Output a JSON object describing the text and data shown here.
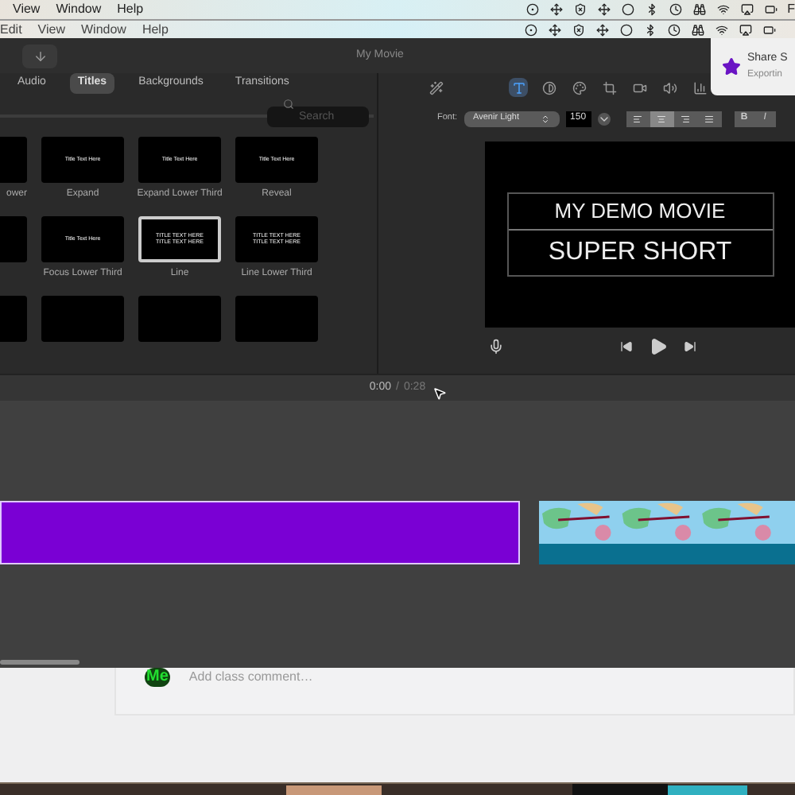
{
  "outer_menu": {
    "items": [
      "View",
      "Window",
      "Help"
    ],
    "status_text": "F"
  },
  "app_menu": {
    "items": [
      "Edit",
      "View",
      "Window",
      "Help"
    ]
  },
  "window": {
    "title": "My Movie"
  },
  "notification": {
    "title": "Share S",
    "subtitle": "Exportin"
  },
  "browser": {
    "tabs": [
      {
        "label": "Audio",
        "selected": false
      },
      {
        "label": "Titles",
        "selected": true
      },
      {
        "label": "Backgrounds",
        "selected": false
      },
      {
        "label": "Transitions",
        "selected": false
      }
    ],
    "search": {
      "placeholder": "Search"
    },
    "titles": [
      {
        "label": "ower",
        "selected": false
      },
      {
        "label": "Expand",
        "preview": [
          "Title Text Here"
        ],
        "selected": false
      },
      {
        "label": "Expand Lower Third",
        "preview": [
          "Title Text Here"
        ],
        "selected": false
      },
      {
        "label": "Reveal",
        "preview": [
          "Title Text Here"
        ],
        "selected": false
      },
      {
        "selected": false
      },
      {
        "label": "Focus Lower Third",
        "preview": [
          "Title Text Here"
        ],
        "selected": false
      },
      {
        "label": "Line",
        "preview": [
          "TITLE TEXT HERE",
          "TITLE TEXT HERE"
        ],
        "selected": true
      },
      {
        "label": "Line Lower Third",
        "preview": [
          "TITLE TEXT HERE",
          "TITLE TEXT HERE"
        ],
        "selected": false
      },
      {
        "selected": false
      },
      {
        "selected": false
      },
      {
        "selected": false
      },
      {
        "selected": false
      }
    ]
  },
  "inspector": {
    "tools": [
      {
        "kind": "wand",
        "selected": false
      },
      {
        "kind": "text",
        "selected": true
      },
      {
        "kind": "color",
        "selected": false
      },
      {
        "kind": "palette",
        "selected": false
      },
      {
        "kind": "crop",
        "selected": false
      },
      {
        "kind": "camera",
        "selected": false
      },
      {
        "kind": "volume",
        "selected": false
      },
      {
        "kind": "chart",
        "selected": false
      }
    ],
    "font_label": "Font:",
    "font_family": "Avenir Light",
    "font_size": "150",
    "alignment": [
      {
        "selected": false
      },
      {
        "selected": true
      },
      {
        "selected": false
      },
      {
        "selected": false
      }
    ],
    "styles": [
      "B",
      "I"
    ]
  },
  "viewer": {
    "lines": [
      "MY DEMO MOVIE",
      "SUPER SHORT"
    ]
  },
  "timeline": {
    "current": "0:00",
    "separator": "/",
    "duration": "0:28",
    "clips": [
      {
        "kind": "title",
        "color": "#7a00d4"
      },
      {
        "kind": "video"
      }
    ]
  },
  "comment": {
    "avatar": "Me",
    "placeholder": "Add class comment…"
  }
}
